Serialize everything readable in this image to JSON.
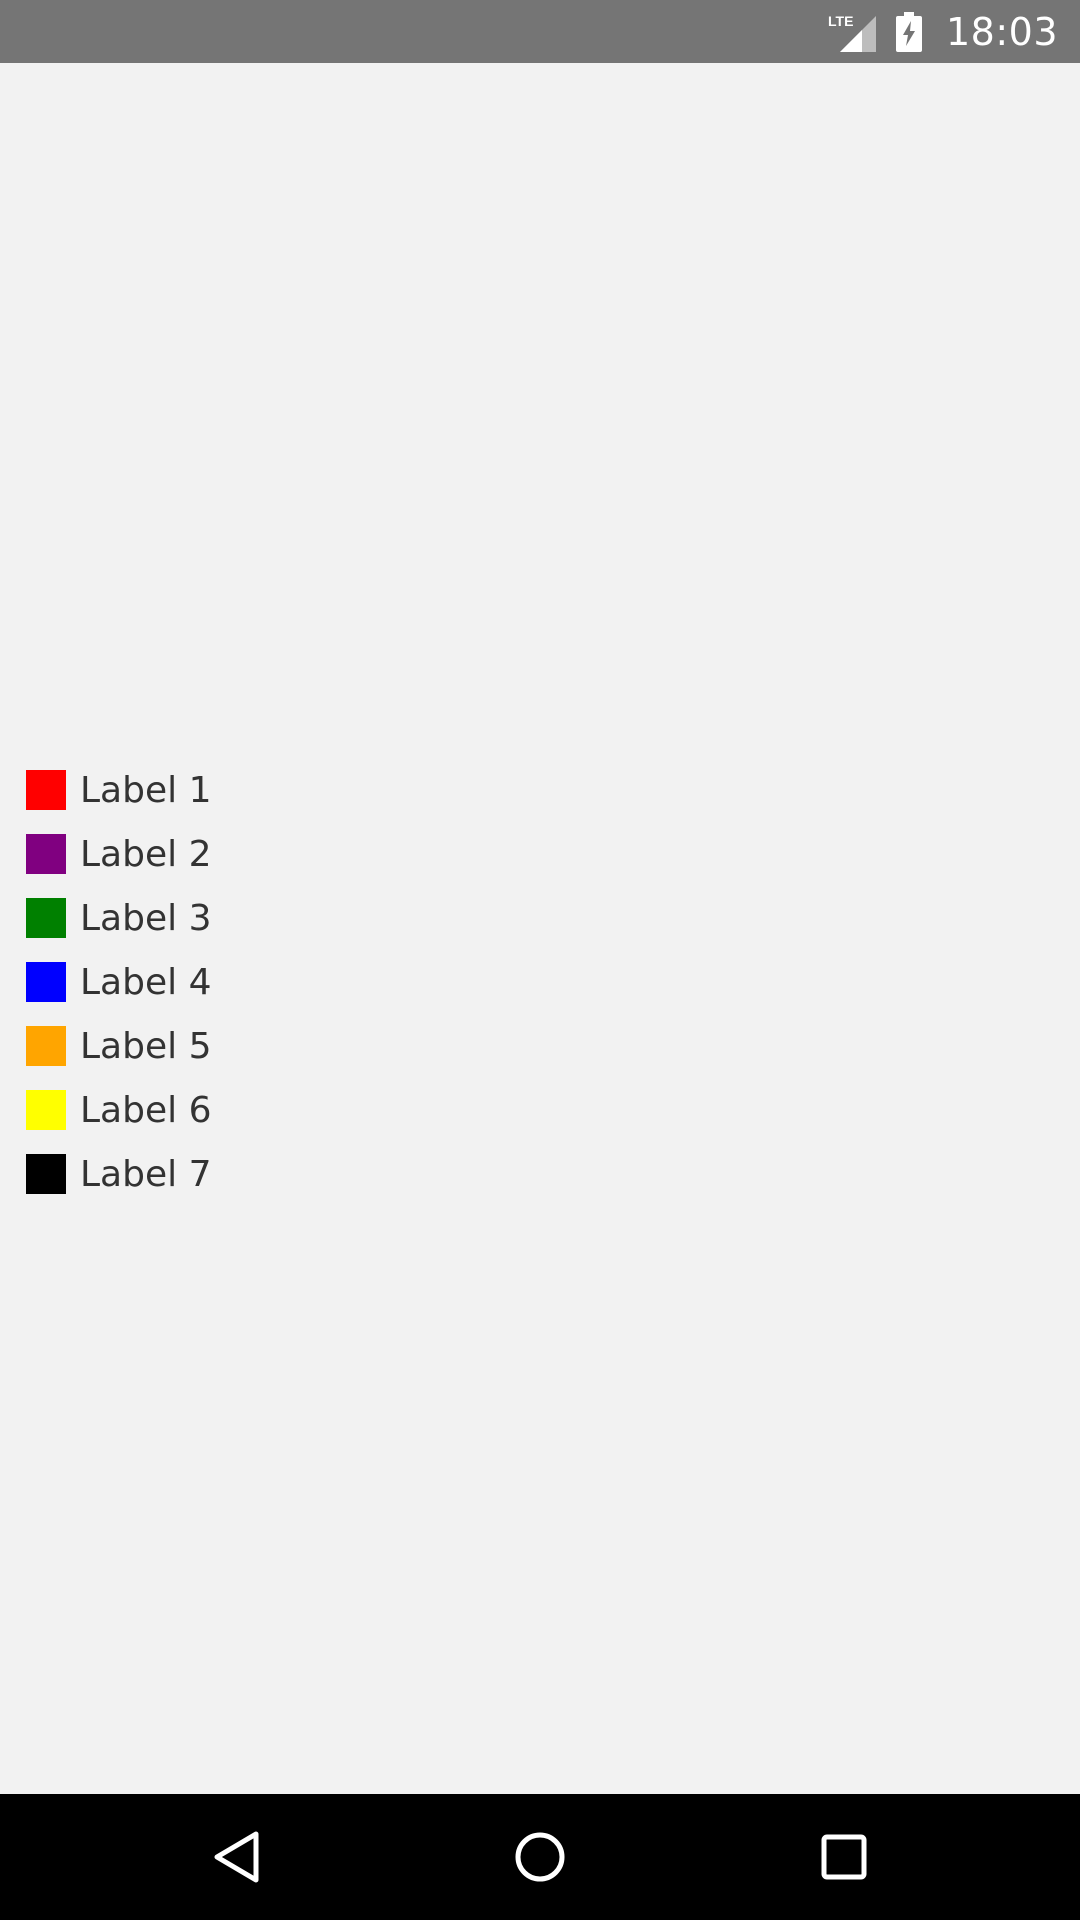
{
  "status_bar": {
    "time": "18:03",
    "network_label": "LTE",
    "icons": [
      "lte-signal-icon",
      "battery-charging-icon"
    ]
  },
  "legend": {
    "items": [
      {
        "label": "Label 1",
        "color": "#ff0000"
      },
      {
        "label": "Label 2",
        "color": "#800080"
      },
      {
        "label": "Label 3",
        "color": "#008000"
      },
      {
        "label": "Label 4",
        "color": "#0000ff"
      },
      {
        "label": "Label 5",
        "color": "#ffa500"
      },
      {
        "label": "Label 6",
        "color": "#ffff00"
      },
      {
        "label": "Label 7",
        "color": "#000000"
      }
    ]
  },
  "nav_bar": {
    "buttons": [
      "back-icon",
      "home-icon",
      "recents-icon"
    ]
  }
}
